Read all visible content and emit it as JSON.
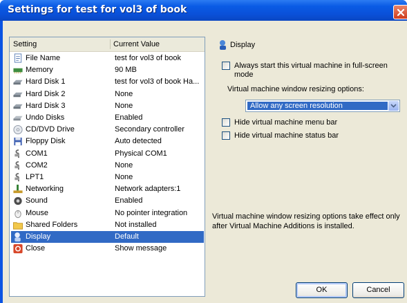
{
  "window": {
    "title": "Settings for test for vol3 of book"
  },
  "list": {
    "columns": [
      "Setting",
      "Current Value"
    ],
    "rows": [
      {
        "name": "File Name",
        "value": "test for vol3 of book",
        "icon": "file-icon"
      },
      {
        "name": "Memory",
        "value": "90 MB",
        "icon": "memory-icon"
      },
      {
        "name": "Hard Disk 1",
        "value": "test for vol3 of book Ha...",
        "icon": "hard-disk-icon"
      },
      {
        "name": "Hard Disk 2",
        "value": "None",
        "icon": "hard-disk-icon"
      },
      {
        "name": "Hard Disk 3",
        "value": "None",
        "icon": "hard-disk-icon"
      },
      {
        "name": "Undo Disks",
        "value": "Enabled",
        "icon": "undo-disks-icon"
      },
      {
        "name": "CD/DVD Drive",
        "value": "Secondary controller",
        "icon": "cd-icon"
      },
      {
        "name": "Floppy Disk",
        "value": "Auto detected",
        "icon": "floppy-icon"
      },
      {
        "name": "COM1",
        "value": "Physical COM1",
        "icon": "com-port-icon"
      },
      {
        "name": "COM2",
        "value": "None",
        "icon": "com-port-icon"
      },
      {
        "name": "LPT1",
        "value": "None",
        "icon": "lpt-port-icon"
      },
      {
        "name": "Networking",
        "value": "Network adapters:1",
        "icon": "network-icon"
      },
      {
        "name": "Sound",
        "value": "Enabled",
        "icon": "sound-icon"
      },
      {
        "name": "Mouse",
        "value": "No pointer integration",
        "icon": "mouse-icon"
      },
      {
        "name": "Shared Folders",
        "value": "Not installed",
        "icon": "folder-icon"
      },
      {
        "name": "Display",
        "value": "Default",
        "icon": "display-icon"
      },
      {
        "name": "Close",
        "value": "Show message",
        "icon": "close-setting-icon"
      }
    ],
    "selected": "Display"
  },
  "panel": {
    "title": "Display",
    "fullscreen_label": "Always start this virtual machine in full-screen mode",
    "resize_label": "Virtual machine window resizing options:",
    "resize_value": "Allow any screen resolution",
    "hide_menu_label": "Hide virtual machine menu bar",
    "hide_status_label": "Hide virtual machine status bar",
    "note": "Virtual machine window resizing options take effect only after Virtual Machine Additions is installed."
  },
  "buttons": {
    "ok": "OK",
    "cancel": "Cancel"
  }
}
